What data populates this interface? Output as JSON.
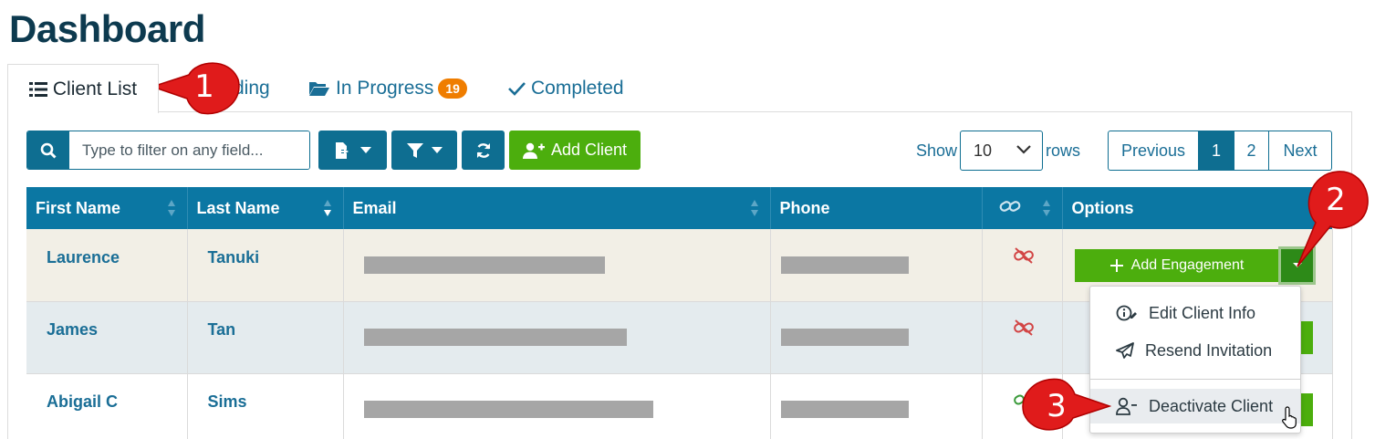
{
  "page": {
    "title": "Dashboard"
  },
  "tabs": [
    {
      "label": "Client List",
      "badge": ""
    },
    {
      "label": "ding",
      "badge": ""
    },
    {
      "label": "In Progress",
      "badge": "19"
    },
    {
      "label": "Completed",
      "badge": ""
    }
  ],
  "toolbar": {
    "search_placeholder": "Type to filter on any field...",
    "add_client_label": "Add Client",
    "show_label": "Show",
    "rows_value": "10",
    "rows_label": "rows"
  },
  "pagination": {
    "previous": "Previous",
    "pages": [
      "1",
      "2"
    ],
    "current": "1",
    "next": "Next"
  },
  "table": {
    "columns": [
      "First Name",
      "Last Name",
      "Email",
      "Phone",
      "",
      "Options"
    ],
    "rows": [
      {
        "first": "Laurence",
        "last": "Tanuki",
        "link_status": "unlinked"
      },
      {
        "first": "James",
        "last": "Tan",
        "link_status": "unlinked"
      },
      {
        "first": "Abigail C",
        "last": "Sims",
        "link_status": "linked"
      }
    ]
  },
  "options": {
    "add_engagement_label": "Add Engagement",
    "menu": [
      "Edit Client Info",
      "Resend Invitation",
      "Deactivate Client"
    ]
  },
  "callouts": [
    "1",
    "2",
    "3"
  ],
  "colors": {
    "primary": "#0e6e91",
    "header": "#0b77a3",
    "success": "#4cae0d",
    "badge": "#ef7d00",
    "callout": "#e01b1b"
  }
}
